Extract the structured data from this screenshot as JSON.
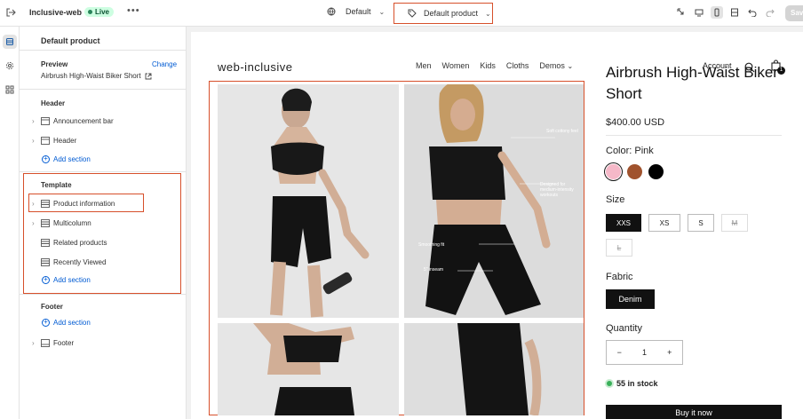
{
  "topbar": {
    "store_name": "Inclusive-web",
    "live_badge": "Live",
    "more": "•••",
    "theme_label": "Default",
    "template_label": "Default product",
    "save_label": "Save"
  },
  "sidebar": {
    "title": "Default product",
    "preview": {
      "heading": "Preview",
      "change_label": "Change",
      "product_name": "Airbrush High-Waist Biker Short"
    },
    "header_group": {
      "heading": "Header",
      "items": [
        "Announcement bar",
        "Header"
      ],
      "add_label": "Add section"
    },
    "template_group": {
      "heading": "Template",
      "items": [
        "Product information",
        "Multicolumn",
        "Related products",
        "Recently Viewed"
      ],
      "add_label": "Add section"
    },
    "footer_group": {
      "heading": "Footer",
      "add_label": "Add section",
      "items": [
        "Footer"
      ]
    }
  },
  "store": {
    "logo": "web-inclusive",
    "nav": [
      "Men",
      "Women",
      "Kids",
      "Cloths",
      "Demos"
    ],
    "account_label": "Account",
    "cart_count": "1"
  },
  "product": {
    "title_line1": "Airbrush High-Waist Biker",
    "title_line2": "Short",
    "price": "$400.00 USD",
    "color_label": "Color: Pink",
    "colors": [
      "#f5b8c8",
      "#a0522d",
      "#000000"
    ],
    "size_label": "Size",
    "sizes": [
      "XXS",
      "XS",
      "S",
      "M",
      "L"
    ],
    "fabric_label": "Fabric",
    "fabric_value": "Denim",
    "quantity_label": "Quantity",
    "quantity_value": "1",
    "stock_text": "55 in stock",
    "buy_label": "Buy it now",
    "photo_notes": [
      "Soft cottony feel",
      "Designed for medium-intensity workouts",
      "Smoothing fit",
      "5\" inseam"
    ]
  },
  "colors": {
    "highlight": "#d7502b",
    "link": "#005bd3",
    "live_bg": "#cdfee1"
  }
}
